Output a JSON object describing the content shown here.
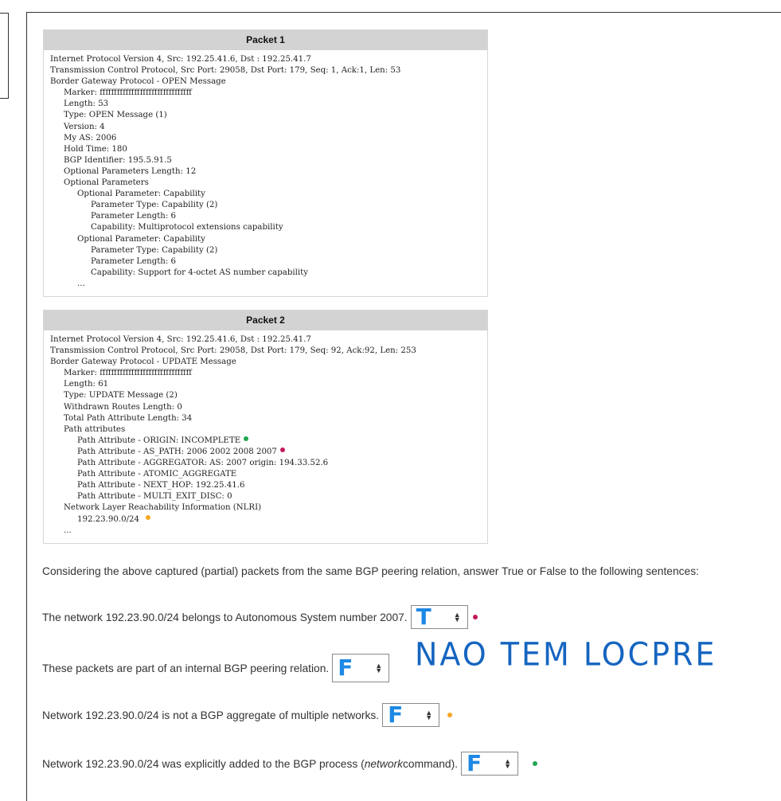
{
  "packet1": {
    "title": "Packet 1",
    "lines": [
      "Internet Protocol Version 4, Src: 192.25.41.6, Dst : 192.25.41.7",
      "Transmission Control Protocol, Src Port: 29058, Dst Port: 179, Seq: 1, Ack:1, Len: 53",
      "Border Gateway Protocol - OPEN Message",
      "Marker: ffffffffffffffffffffffffffffffff",
      "Length: 53",
      "Type: OPEN Message (1)",
      "Version: 4",
      "My AS: 2006",
      "Hold Time: 180",
      "BGP Identifier: 195.5.91.5",
      "Optional Parameters Length: 12",
      "Optional Parameters",
      "Optional Parameter: Capability",
      "Parameter Type: Capability (2)",
      "Parameter Length: 6",
      "Capability: Multiprotocol extensions capability",
      "Optional Parameter: Capability",
      "Parameter Type: Capability (2)",
      "Parameter Length: 6",
      "Capability: Support for 4-octet AS number capability",
      "..."
    ]
  },
  "packet2": {
    "title": "Packet 2",
    "lines": [
      "Internet Protocol Version 4, Src: 192.25.41.6, Dst : 192.25.41.7",
      "Transmission Control Protocol, Src Port: 29058, Dst Port: 179, Seq: 92, Ack:92, Len: 253",
      "Border Gateway Protocol - UPDATE Message",
      "Marker: ffffffffffffffffffffffffffffffff",
      "Length: 61",
      "Type: UPDATE Message (2)",
      "Withdrawn Routes Length: 0",
      "Total Path Attribute Length: 34",
      "Path attributes",
      "Path Attribute - ORIGIN: INCOMPLETE",
      "Path Attribute - AS_PATH: 2006 2002 2008 2007",
      "Path Attribute - AGGREGATOR: AS: 2007 origin: 194.33.52.6",
      "Path Attribute - ATOMIC_AGGREGATE",
      "Path Attribute - NEXT_HOP: 192.25.41.6",
      "Path Attribute - MULTI_EXIT_DISC: 0",
      "Network Layer Reachability Information (NLRI)",
      "192.23.90.0/24",
      "..."
    ]
  },
  "question": "Considering the above captured (partial) packets from the same BGP peering relation, answer True or False to the following sentences:",
  "sentences": [
    {
      "text": "The network 192.23.90.0/24 belongs to Autonomous System number 2007.",
      "value": "T"
    },
    {
      "text": "These packets are part of an internal BGP peering relation.",
      "value": "F"
    },
    {
      "text": "Network 192.23.90.0/24 is not a BGP aggregate of multiple networks.",
      "value": "F"
    },
    {
      "text_before": "Network 192.23.90.0/24 was explicitly added to the BGP process (",
      "text_em": "network",
      "text_after": " command).",
      "value": "F"
    }
  ],
  "handwritten_note": "NAO TEM LOCPRE",
  "colors": {
    "green": "#1fa751",
    "magenta": "#c2185b",
    "orange": "#f5a623",
    "ink": "#1e88e5"
  }
}
